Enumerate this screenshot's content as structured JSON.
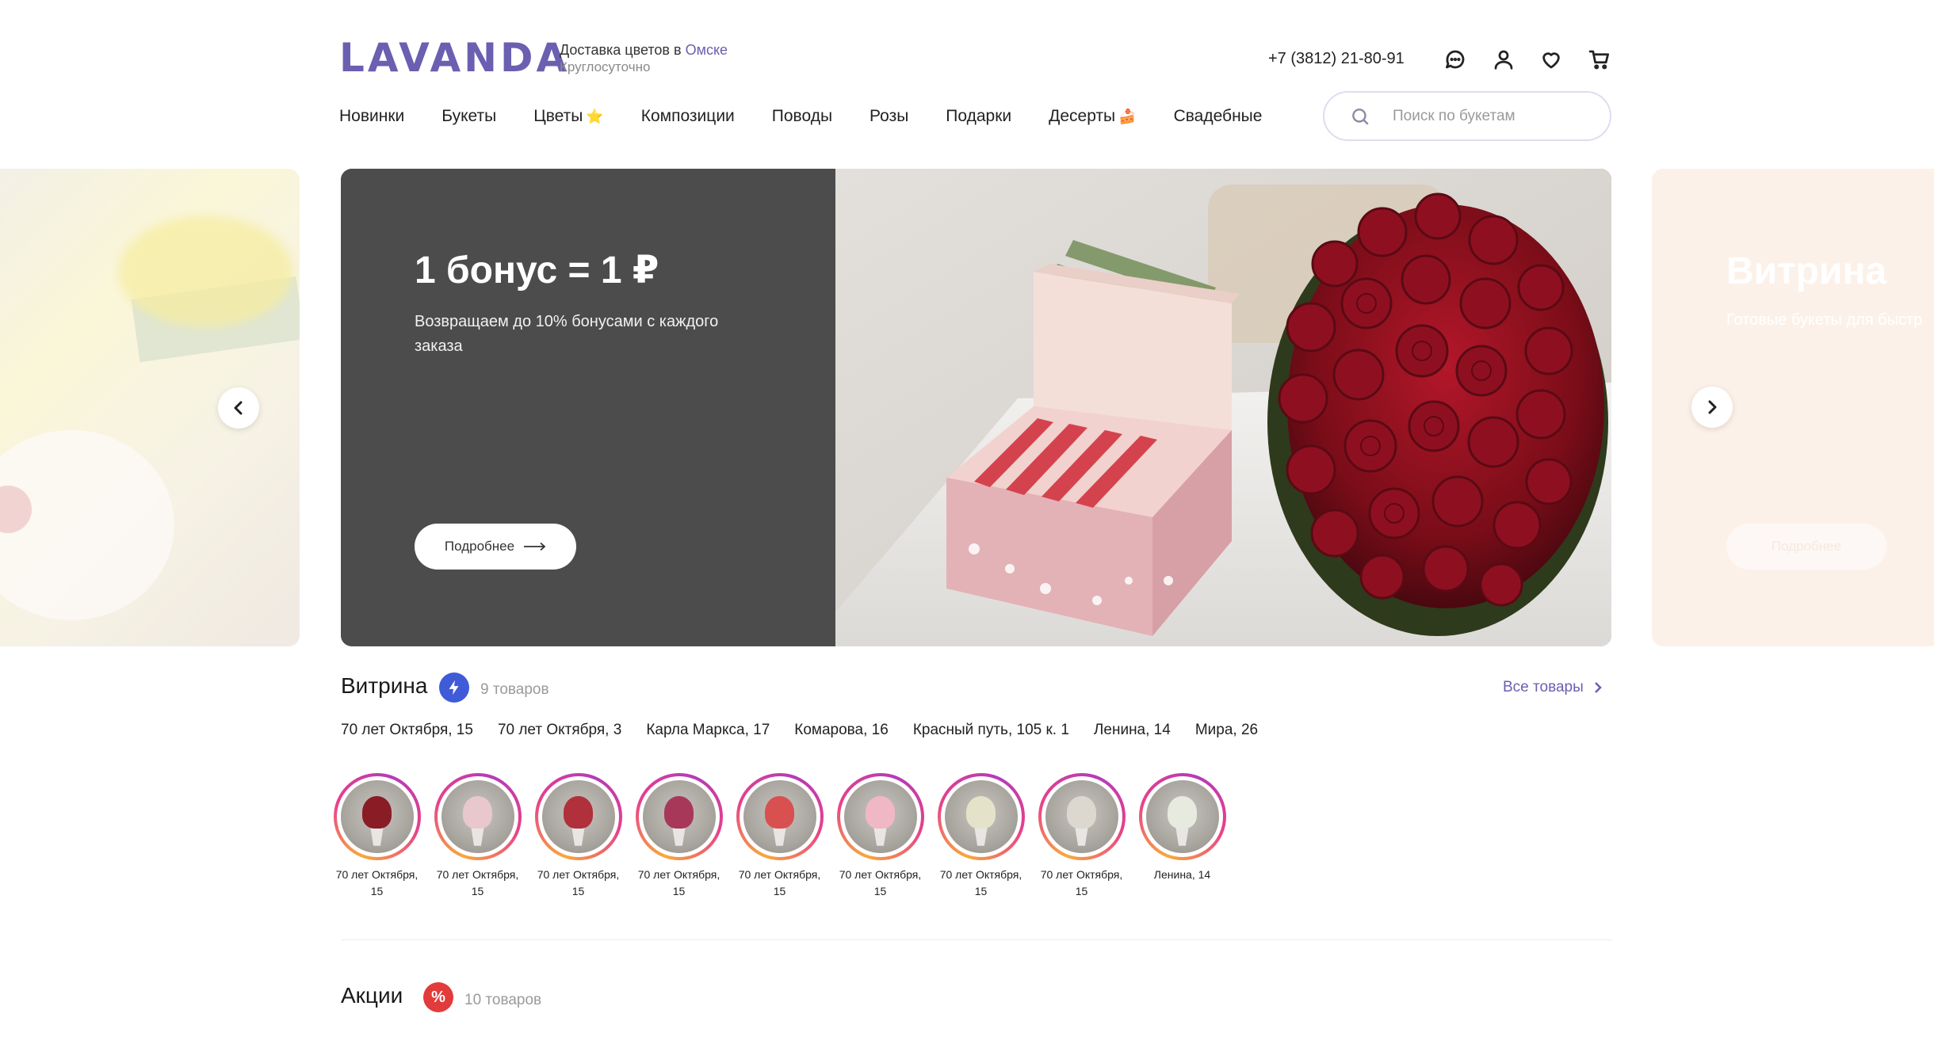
{
  "header": {
    "logo": "LAVANDA",
    "delivery_prefix": "Доставка цветов в ",
    "delivery_city": "Омске",
    "delivery_hours": "Круглосуточно",
    "phone": "+7 (3812) 21-80-91",
    "icons": [
      "chat-icon",
      "user-icon",
      "heart-icon",
      "cart-icon"
    ]
  },
  "nav": {
    "items": [
      {
        "label": "Новинки",
        "emoji": ""
      },
      {
        "label": "Букеты",
        "emoji": ""
      },
      {
        "label": "Цветы",
        "emoji": "⭐"
      },
      {
        "label": "Композиции",
        "emoji": ""
      },
      {
        "label": "Поводы",
        "emoji": ""
      },
      {
        "label": "Розы",
        "emoji": ""
      },
      {
        "label": "Подарки",
        "emoji": ""
      },
      {
        "label": "Десерты",
        "emoji": "🍰"
      },
      {
        "label": "Свадебные",
        "emoji": ""
      }
    ]
  },
  "search": {
    "placeholder": "Поиск по букетам"
  },
  "carousel": {
    "slide": {
      "title": "1 бонус = 1 ₽",
      "subtitle": "Возвращаем до 10% бонусами с каждого заказа",
      "button": "Подробнее"
    },
    "next_slide": {
      "title": "Витрина",
      "subtitle": "Готовые букеты для быстр",
      "button": "Подробнее"
    }
  },
  "vitrina": {
    "title": "Витрина",
    "count": "9 товаров",
    "all_link": "Все товары",
    "addresses": [
      "70 лет Октября, 15",
      "70 лет Октября, 3",
      "Карла Маркса, 17",
      "Комарова, 16",
      "Красный путь, 105 к. 1",
      "Ленина, 14",
      "Мира, 26"
    ],
    "stories": [
      {
        "label": "70 лет Октября, 15",
        "flower": "#8a1c26"
      },
      {
        "label": "70 лет Октября, 15",
        "flower": "#e8c8cc"
      },
      {
        "label": "70 лет Октября, 15",
        "flower": "#b0303c"
      },
      {
        "label": "70 лет Октября, 15",
        "flower": "#a8385a"
      },
      {
        "label": "70 лет Октября, 15",
        "flower": "#d85050"
      },
      {
        "label": "70 лет Октября, 15",
        "flower": "#f0b8c4"
      },
      {
        "label": "70 лет Октября, 15",
        "flower": "#e4e2c8"
      },
      {
        "label": "70 лет Октября, 15",
        "flower": "#dcd8d0"
      },
      {
        "label": "Ленина, 14",
        "flower": "#e6eadf"
      }
    ]
  },
  "akcii": {
    "title": "Акции",
    "count": "10 товаров"
  },
  "colors": {
    "accent": "#6a5fb0",
    "bolt_badge": "#3f5bd8",
    "sale_badge": "#e23b3b"
  }
}
